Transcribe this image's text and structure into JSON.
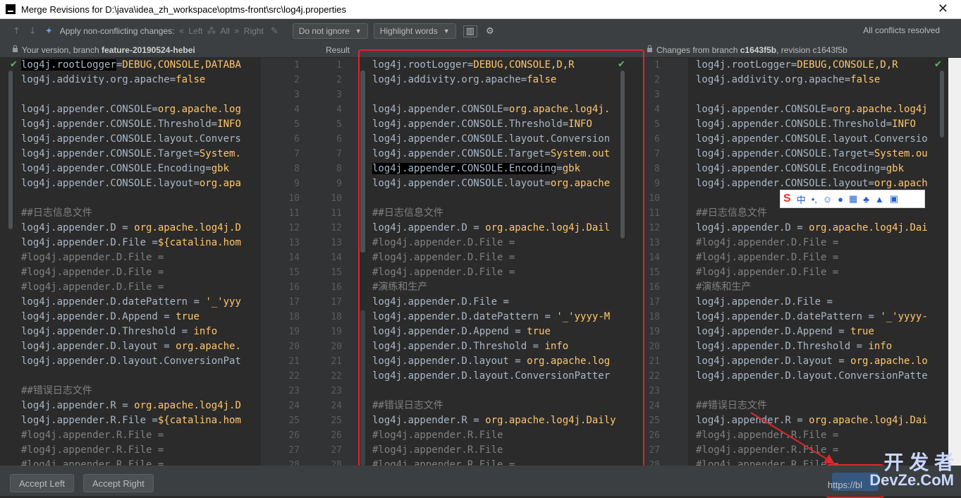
{
  "window": {
    "title": "Merge Revisions for D:\\java\\idea_zh_workspace\\optms-front\\src\\log4j.properties"
  },
  "toolbar": {
    "apply_label": "Apply non-conflicting changes:",
    "left": "Left",
    "all": "All",
    "right": "Right",
    "ignore_combo": "Do not ignore",
    "highlight_combo": "Highlight words",
    "status": "All conflicts resolved"
  },
  "headers": {
    "left_prefix": "Your version, branch ",
    "left_branch": "feature-20190524-hebei",
    "middle": "Result",
    "right_prefix": "Changes from branch ",
    "right_branch": "c1643f5b",
    "right_suffix": ", revision c1643f5b"
  },
  "left_lines": [
    [
      [
        "k",
        "log4j.rootLogger"
      ],
      [
        "k",
        "="
      ],
      [
        "v",
        "DEBUG,CONSOLE,DATABA"
      ]
    ],
    [
      [
        "k",
        "log4j.addivity.org.apache"
      ],
      [
        "k",
        "="
      ],
      [
        "v",
        "false"
      ]
    ],
    [],
    [
      [
        "k",
        "log4j.appender.CONSOLE"
      ],
      [
        "k",
        "="
      ],
      [
        "v",
        "org.apache.log"
      ]
    ],
    [
      [
        "k",
        "log4j.appender.CONSOLE.Threshold"
      ],
      [
        "k",
        "="
      ],
      [
        "v",
        "INFO"
      ]
    ],
    [
      [
        "k",
        "log4j.appender.CONSOLE.layout.Convers"
      ]
    ],
    [
      [
        "k",
        "log4j.appender.CONSOLE.Target"
      ],
      [
        "k",
        "="
      ],
      [
        "v",
        "System."
      ]
    ],
    [
      [
        "k",
        "log4j.appender.CONSOLE.Encoding"
      ],
      [
        "k",
        "="
      ],
      [
        "v",
        "gbk"
      ]
    ],
    [
      [
        "k",
        "log4j.appender.CONSOLE.layout"
      ],
      [
        "k",
        "="
      ],
      [
        "v",
        "org.apa"
      ]
    ],
    [],
    [
      [
        "c",
        "##日志信息文件"
      ]
    ],
    [
      [
        "k",
        "log4j.appender.D"
      ],
      [
        "k",
        " = "
      ],
      [
        "v",
        "org.apache.log4j.D"
      ]
    ],
    [
      [
        "k",
        "log4j.appender.D.File"
      ],
      [
        "k",
        " ="
      ],
      [
        "v",
        "${catalina.hom"
      ]
    ],
    [
      [
        "c",
        "#log4j.appender.D.File ="
      ]
    ],
    [
      [
        "c",
        "#log4j.appender.D.File ="
      ]
    ],
    [
      [
        "c",
        "#log4j.appender.D.File ="
      ]
    ],
    [
      [
        "k",
        "log4j.appender.D.datePattern"
      ],
      [
        "k",
        " = "
      ],
      [
        "v",
        "'_'yyy"
      ]
    ],
    [
      [
        "k",
        "log4j.appender.D.Append"
      ],
      [
        "k",
        " = "
      ],
      [
        "v",
        "true"
      ]
    ],
    [
      [
        "k",
        "log4j.appender.D.Threshold"
      ],
      [
        "k",
        " = "
      ],
      [
        "v",
        "info"
      ]
    ],
    [
      [
        "k",
        "log4j.appender.D.layout"
      ],
      [
        "k",
        " = "
      ],
      [
        "v",
        "org.apache."
      ]
    ],
    [
      [
        "k",
        "log4j.appender.D.layout.ConversionPat"
      ]
    ],
    [],
    [
      [
        "c",
        "##错误日志文件"
      ]
    ],
    [
      [
        "k",
        "log4j.appender.R"
      ],
      [
        "k",
        " = "
      ],
      [
        "v",
        "org.apache.log4j.D"
      ]
    ],
    [
      [
        "k",
        "log4j.appender.R.File"
      ],
      [
        "k",
        " ="
      ],
      [
        "v",
        "${catalina.hom"
      ]
    ],
    [
      [
        "c",
        "#log4j.appender.R.File ="
      ]
    ],
    [
      [
        "c",
        "#log4j.appender.R.File ="
      ]
    ],
    [
      [
        "c",
        "#log4j.appender.R.File ="
      ]
    ]
  ],
  "middle_lines": [
    [
      [
        "k",
        "log4j.rootLogger"
      ],
      [
        "k",
        "="
      ],
      [
        "v",
        "DEBUG,CONSOLE,D,R"
      ]
    ],
    [
      [
        "k",
        "log4j.addivity.org.apache"
      ],
      [
        "k",
        "="
      ],
      [
        "v",
        "false"
      ]
    ],
    [],
    [
      [
        "k",
        "log4j.appender.CONSOLE"
      ],
      [
        "k",
        "="
      ],
      [
        "v",
        "org.apache.log4j."
      ]
    ],
    [
      [
        "k",
        "log4j.appender.CONSOLE.Threshold"
      ],
      [
        "k",
        "="
      ],
      [
        "v",
        "INFO"
      ]
    ],
    [
      [
        "k",
        "log4j.appender.CONSOLE.layout.Conversion"
      ]
    ],
    [
      [
        "k",
        "log4j.appender.CONSOLE.Target"
      ],
      [
        "k",
        "="
      ],
      [
        "v",
        "System.out"
      ]
    ],
    [
      [
        "k",
        "log4j.appender.CONSOLE.Encoding"
      ],
      [
        "k",
        "="
      ],
      [
        "v",
        "gbk"
      ]
    ],
    [
      [
        "k",
        "log4j.appender.CONSOLE.layout"
      ],
      [
        "k",
        "="
      ],
      [
        "v",
        "org.apache"
      ]
    ],
    [],
    [
      [
        "c",
        "##日志信息文件"
      ]
    ],
    [
      [
        "k",
        "log4j.appender.D"
      ],
      [
        "k",
        " = "
      ],
      [
        "v",
        "org.apache.log4j.Dail"
      ]
    ],
    [
      [
        "c",
        "#log4j.appender.D.File ="
      ]
    ],
    [
      [
        "c",
        "#log4j.appender.D.File ="
      ]
    ],
    [
      [
        "c",
        "#log4j.appender.D.File ="
      ]
    ],
    [
      [
        "c",
        "#演练和生产"
      ]
    ],
    [
      [
        "k",
        "log4j.appender.D.File"
      ],
      [
        "k",
        " ="
      ]
    ],
    [
      [
        "k",
        "log4j.appender.D.datePattern"
      ],
      [
        "k",
        " = "
      ],
      [
        "v",
        "'_'yyyy-M"
      ]
    ],
    [
      [
        "k",
        "log4j.appender.D.Append"
      ],
      [
        "k",
        " = "
      ],
      [
        "v",
        "true"
      ]
    ],
    [
      [
        "k",
        "log4j.appender.D.Threshold"
      ],
      [
        "k",
        " = "
      ],
      [
        "v",
        "info"
      ]
    ],
    [
      [
        "k",
        "log4j.appender.D.layout"
      ],
      [
        "k",
        " = "
      ],
      [
        "v",
        "org.apache.log"
      ]
    ],
    [
      [
        "k",
        "log4j.appender.D.layout.ConversionPatter"
      ]
    ],
    [],
    [
      [
        "c",
        "##错误日志文件"
      ]
    ],
    [
      [
        "k",
        "log4j.appender.R"
      ],
      [
        "k",
        " = "
      ],
      [
        "v",
        "org.apache.log4j.Daily"
      ]
    ],
    [
      [
        "c",
        "#log4j.appender.R.File"
      ]
    ],
    [
      [
        "c",
        "#log4j.appender.R.File"
      ]
    ],
    [
      [
        "c",
        "#log4j.appender.R.File ="
      ]
    ]
  ],
  "right_lines": [
    [
      [
        "k",
        "log4j.rootLogger"
      ],
      [
        "k",
        "="
      ],
      [
        "v",
        "DEBUG,CONSOLE,D,R"
      ]
    ],
    [
      [
        "k",
        "log4j.addivity.org.apache"
      ],
      [
        "k",
        "="
      ],
      [
        "v",
        "false"
      ]
    ],
    [],
    [
      [
        "k",
        "log4j.appender.CONSOLE"
      ],
      [
        "k",
        "="
      ],
      [
        "v",
        "org.apache.log4j"
      ]
    ],
    [
      [
        "k",
        "log4j.appender.CONSOLE.Threshold"
      ],
      [
        "k",
        "="
      ],
      [
        "v",
        "INFO"
      ]
    ],
    [
      [
        "k",
        "log4j.appender.CONSOLE.layout.Conversio"
      ]
    ],
    [
      [
        "k",
        "log4j.appender.CONSOLE.Target"
      ],
      [
        "k",
        "="
      ],
      [
        "v",
        "System.ou"
      ]
    ],
    [
      [
        "k",
        "log4j.appender.CONSOLE.Encoding"
      ],
      [
        "k",
        "="
      ],
      [
        "v",
        "gbk"
      ]
    ],
    [
      [
        "k",
        "log4j.appender.CONSOLE.layout"
      ],
      [
        "k",
        "="
      ],
      [
        "v",
        "org.apach"
      ]
    ],
    [],
    [
      [
        "c",
        "##日志信息文件"
      ]
    ],
    [
      [
        "k",
        "log4j.appender.D"
      ],
      [
        "k",
        " = "
      ],
      [
        "v",
        "org.apache.log4j.Dai"
      ]
    ],
    [
      [
        "c",
        "#log4j.appender.D.File ="
      ]
    ],
    [
      [
        "c",
        "#log4j.appender.D.File ="
      ]
    ],
    [
      [
        "c",
        "#log4j.appender.D.File ="
      ]
    ],
    [
      [
        "c",
        "#演练和生产"
      ]
    ],
    [
      [
        "k",
        "log4j.appender.D.File"
      ],
      [
        "k",
        " ="
      ]
    ],
    [
      [
        "k",
        "log4j.appender.D.datePattern"
      ],
      [
        "k",
        " = "
      ],
      [
        "v",
        "'_'yyyy-"
      ]
    ],
    [
      [
        "k",
        "log4j.appender.D.Append"
      ],
      [
        "k",
        " = "
      ],
      [
        "v",
        "true"
      ]
    ],
    [
      [
        "k",
        "log4j.appender.D.Threshold"
      ],
      [
        "k",
        " = "
      ],
      [
        "v",
        "info"
      ]
    ],
    [
      [
        "k",
        "log4j.appender.D.layout"
      ],
      [
        "k",
        " = "
      ],
      [
        "v",
        "org.apache.lo"
      ]
    ],
    [
      [
        "k",
        "log4j.appender.D.layout.ConversionPatte"
      ]
    ],
    [],
    [
      [
        "c",
        "##错误日志文件"
      ]
    ],
    [
      [
        "k",
        "log4j.appender.R"
      ],
      [
        "k",
        " = "
      ],
      [
        "v",
        "org.apache.log4j.Dai"
      ]
    ],
    [
      [
        "c",
        "#log4j.appender.R.File ="
      ]
    ],
    [
      [
        "c",
        "#log4j.appender.R.File ="
      ]
    ],
    [
      [
        "c",
        "#log4j.appender.R.File ="
      ]
    ]
  ],
  "gutter_left_numbers": [
    "1",
    "2",
    "3",
    "4",
    "5",
    "6",
    "7",
    "8",
    "9",
    "10",
    "11",
    "12",
    "13",
    "14",
    "15",
    "16",
    "17",
    "18",
    "19",
    "20",
    "21",
    "22",
    "23",
    "24",
    "25",
    "26",
    "27",
    "28"
  ],
  "gutter_result_numbers": [
    "1",
    "2",
    "3",
    "4",
    "5",
    "6",
    "7",
    "8",
    "9",
    "10",
    "11",
    "12",
    "13",
    "14",
    "15",
    "16",
    "17",
    "18",
    "19",
    "20",
    "21",
    "22",
    "23",
    "24",
    "25",
    "26",
    "27",
    "28"
  ],
  "gutter_right_numbers": [
    "1",
    "2",
    "3",
    "4",
    "5",
    "6",
    "7",
    "8",
    "9",
    "10",
    "11",
    "12",
    "13",
    "14",
    "15",
    "16",
    "17",
    "18",
    "19",
    "20",
    "21",
    "22",
    "23",
    "24",
    "25",
    "26",
    "27",
    "28"
  ],
  "ime": {
    "logo": "S",
    "lang": "中",
    "punct": "•,"
  },
  "bottom": {
    "accept_left": "Accept Left",
    "accept_right": "Accept Right",
    "watermark": "开 发 者",
    "watermark_sub": "DevZe.CoM",
    "watermark_url": "https://bl"
  }
}
